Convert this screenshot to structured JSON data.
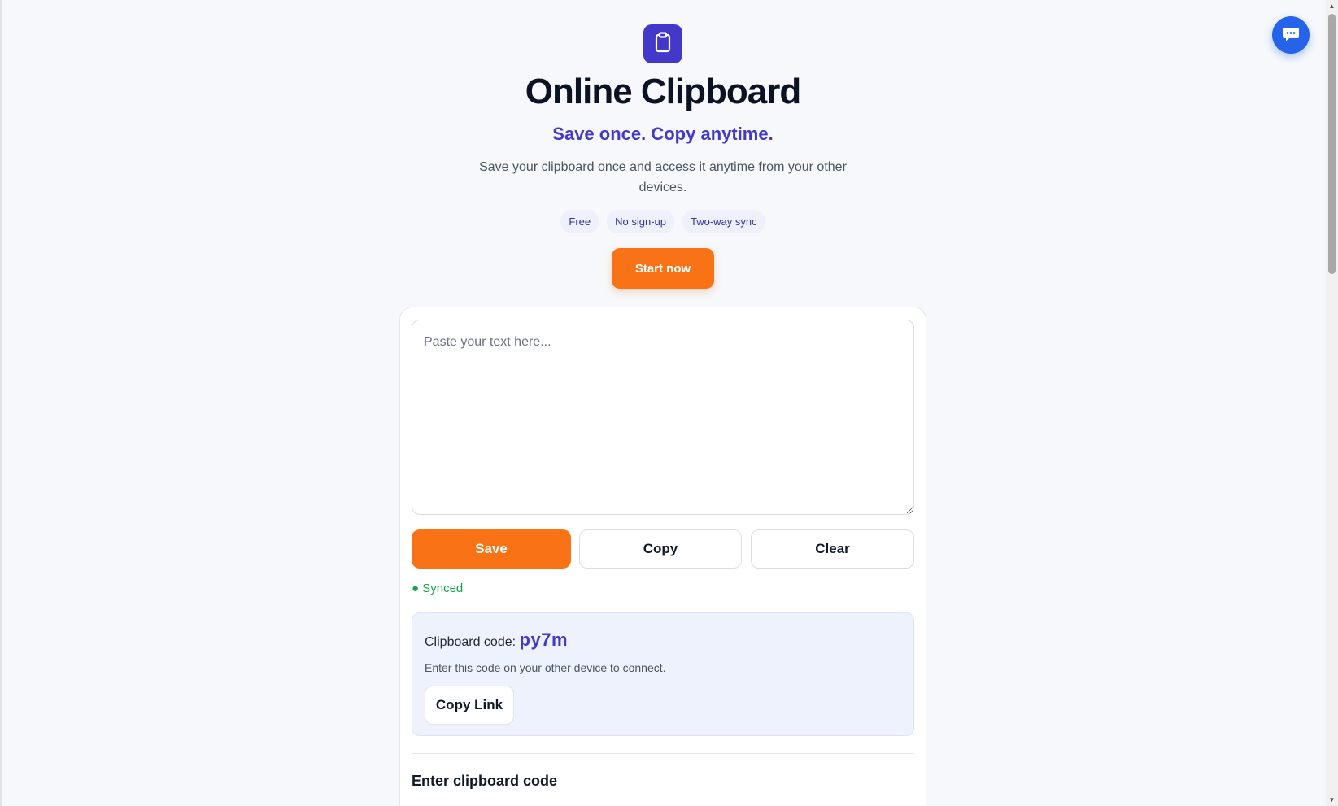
{
  "hero": {
    "title": "Online Clipboard",
    "tagline": "Save once. Copy anytime.",
    "description": "Save your clipboard once and access it anytime from your other devices.",
    "pills": [
      "Free",
      "No sign-up",
      "Two-way sync"
    ],
    "start_label": "Start now"
  },
  "editor": {
    "placeholder": "Paste your text here...",
    "value": "",
    "save_label": "Save",
    "copy_label": "Copy",
    "clear_label": "Clear",
    "status": "● Synced"
  },
  "code_panel": {
    "label": "Clipboard code:",
    "code": "py7m",
    "hint": "Enter this code on your other device to connect.",
    "copy_link_label": "Copy Link"
  },
  "enter_code": {
    "heading": "Enter clipboard code"
  },
  "icons": {
    "logo": "clipboard-icon",
    "chat": "chat-icon"
  },
  "colors": {
    "brand": "#4338ca",
    "accent": "#f97316",
    "status_ok": "#16a34a",
    "chat_button": "#2563eb"
  }
}
